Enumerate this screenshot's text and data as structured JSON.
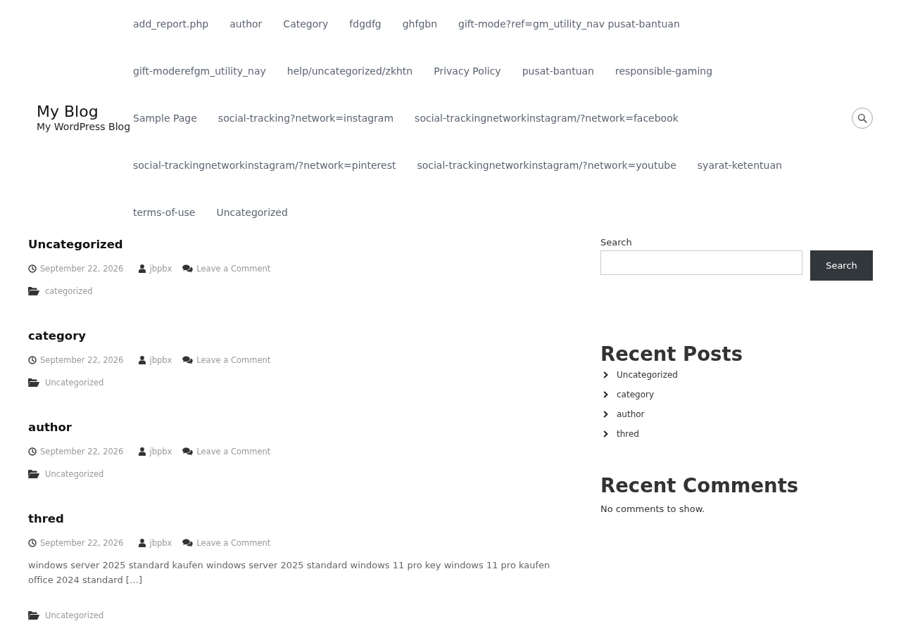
{
  "header": {
    "site_title": "My Blog",
    "tagline": "My WordPress Blog",
    "nav": [
      {
        "label": "add_report.php"
      },
      {
        "label": "author"
      },
      {
        "label": "Category"
      },
      {
        "label": "fdgdfg"
      },
      {
        "label": "ghfgbn"
      },
      {
        "label": "gift-mode?ref=gm_utility_nav pusat-bantuan"
      },
      {
        "label": "gift-moderefgm_utility_nay"
      },
      {
        "label": "help/uncategorized/zkhtn"
      },
      {
        "label": "Privacy Policy"
      },
      {
        "label": "pusat-bantuan"
      },
      {
        "label": "responsible-gaming"
      },
      {
        "label": "Sample Page"
      },
      {
        "label": "social-tracking?network=instagram"
      },
      {
        "label": "social-trackingnetworkinstagram/?network=facebook"
      },
      {
        "label": "social-trackingnetworkinstagram/?network=pinterest"
      },
      {
        "label": "social-trackingnetworkinstagram/?network=youtube"
      },
      {
        "label": "syarat-ketentuan"
      },
      {
        "label": "terms-of-use"
      },
      {
        "label": "Uncategorized"
      }
    ]
  },
  "posts": [
    {
      "title": "Uncategorized",
      "date": "September 22, 2026",
      "author": "jbpbx",
      "comments": "Leave a Comment",
      "category": "categorized"
    },
    {
      "title": "category",
      "date": "September 22, 2026",
      "author": "jbpbx",
      "comments": "Leave a Comment",
      "category": "Uncategorized"
    },
    {
      "title": "author",
      "date": "September 22, 2026",
      "author": "jbpbx",
      "comments": "Leave a Comment",
      "category": "Uncategorized"
    },
    {
      "title": "thred",
      "date": "September 22, 2026",
      "author": "jbpbx",
      "comments": "Leave a Comment",
      "excerpt": "windows server 2025 standard kaufen windows server 2025 standard windows 11 pro key windows 11 pro kaufen office 2024 standard […]",
      "category": "Uncategorized"
    }
  ],
  "sidebar": {
    "search": {
      "label": "Search",
      "button": "Search"
    },
    "recent_posts": {
      "title": "Recent Posts",
      "items": [
        "Uncategorized",
        "category",
        "author",
        "thred"
      ]
    },
    "recent_comments": {
      "title": "Recent Comments",
      "text": "No comments to show."
    }
  }
}
